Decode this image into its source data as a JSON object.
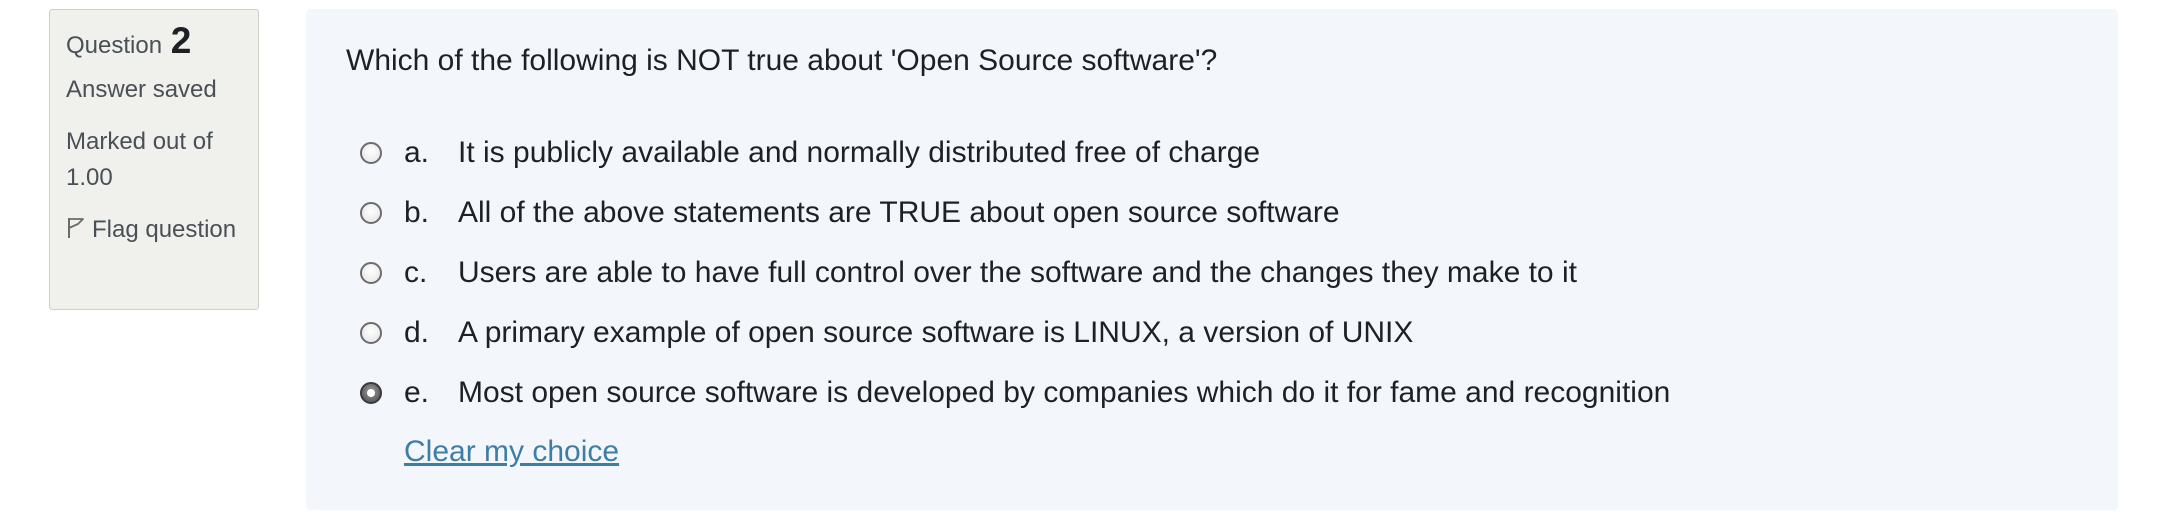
{
  "info": {
    "question_label": "Question",
    "question_number": "2",
    "state": "Answer saved",
    "grade": "Marked out of 1.00",
    "flag_label": "Flag question"
  },
  "question": {
    "text": "Which of the following is NOT true about 'Open Source software'?",
    "options": [
      {
        "letter": "a.",
        "text": "It is publicly available and normally distributed free of charge",
        "selected": false
      },
      {
        "letter": "b.",
        "text": "All of the above statements are TRUE about open source software",
        "selected": false
      },
      {
        "letter": "c.",
        "text": "Users are able to have full control over the software and the changes they make to it",
        "selected": false
      },
      {
        "letter": "d.",
        "text": "A primary example of open source software is LINUX, a version of UNIX",
        "selected": false
      },
      {
        "letter": "e.",
        "text": "Most open source software is developed by companies which do it for fame and recognition",
        "selected": true
      }
    ],
    "clear_label": "Clear my choice"
  },
  "colors": {
    "link": "#3d7ea6",
    "info_background": "#f0f0ec",
    "question_background": "#f3f6fb"
  }
}
